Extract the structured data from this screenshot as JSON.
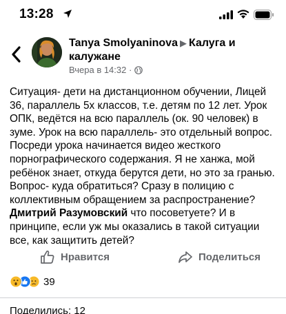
{
  "status_bar": {
    "time": "13:28"
  },
  "post": {
    "author": "Tanya Smolyaninova",
    "group_arrow": "▶",
    "group": "Калуга и калужане",
    "timestamp": "Вчера в 14:32 ·",
    "body": {
      "p1": "Ситуация- дети на дистанционном обучении, Лицей 36, параллель 5х классов, т.е. детям по 12 лет. Урок ОПК, ведётся на всю параллель (ок. 90 человек) в зуме. Урок на всю параллель- это отдельный вопрос. Посреди урока начинается видео жесткого порнографического содержания. Я не ханжа, мой ребёнок знает, откуда берутся дети, но это за гранью.",
      "p2": "Вопрос- куда обратиться? Сразу в полицию с коллективным обращением за распространение?",
      "mention": "Дмитрий Разумовский",
      "p3_rest": " что посоветуете? И в принципе, если уж мы оказались в такой ситуации все, как защитить детей?"
    }
  },
  "actions": {
    "like_label": "Нравится",
    "share_label": "Поделиться"
  },
  "reactions": {
    "count": "39",
    "types": [
      "wow",
      "like",
      "sad"
    ]
  },
  "shares": {
    "label": "Поделились: 12"
  },
  "colors": {
    "text": "#050505",
    "secondary": "#65676b",
    "like_blue": "#1877f2",
    "reaction_yellow": "#f7b928"
  }
}
